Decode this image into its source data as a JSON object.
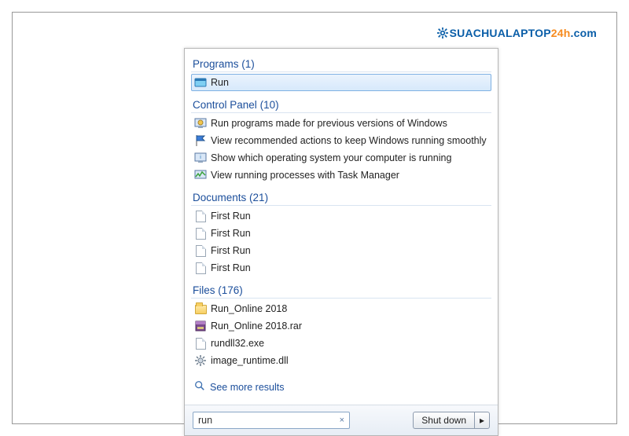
{
  "watermark": {
    "part1": "SUACHUALAPTOP",
    "part2": "24h",
    "part3": ".com"
  },
  "sections": {
    "programs": {
      "label": "Programs",
      "count": 1
    },
    "control_panel": {
      "label": "Control Panel",
      "count": 10
    },
    "documents": {
      "label": "Documents",
      "count": 21
    },
    "files": {
      "label": "Files",
      "count": 176
    }
  },
  "programs_items": [
    {
      "label": "Run"
    }
  ],
  "control_panel_items": [
    {
      "label": "Run programs made for previous versions of Windows"
    },
    {
      "label": "View recommended actions to keep Windows running smoothly"
    },
    {
      "label": "Show which operating system your computer is running"
    },
    {
      "label": "View running processes with Task Manager"
    }
  ],
  "documents_items": [
    {
      "label": "First Run"
    },
    {
      "label": "First Run"
    },
    {
      "label": "First Run"
    },
    {
      "label": "First Run"
    }
  ],
  "files_items": [
    {
      "label": "Run_Online 2018",
      "icon": "folder"
    },
    {
      "label": "Run_Online 2018.rar",
      "icon": "rar"
    },
    {
      "label": "rundll32.exe",
      "icon": "page"
    },
    {
      "label": "image_runtime.dll",
      "icon": "gear"
    }
  ],
  "see_more": "See more results",
  "search": {
    "value": "run",
    "clear": "×"
  },
  "shutdown": {
    "label": "Shut down",
    "arrow": "▸"
  }
}
